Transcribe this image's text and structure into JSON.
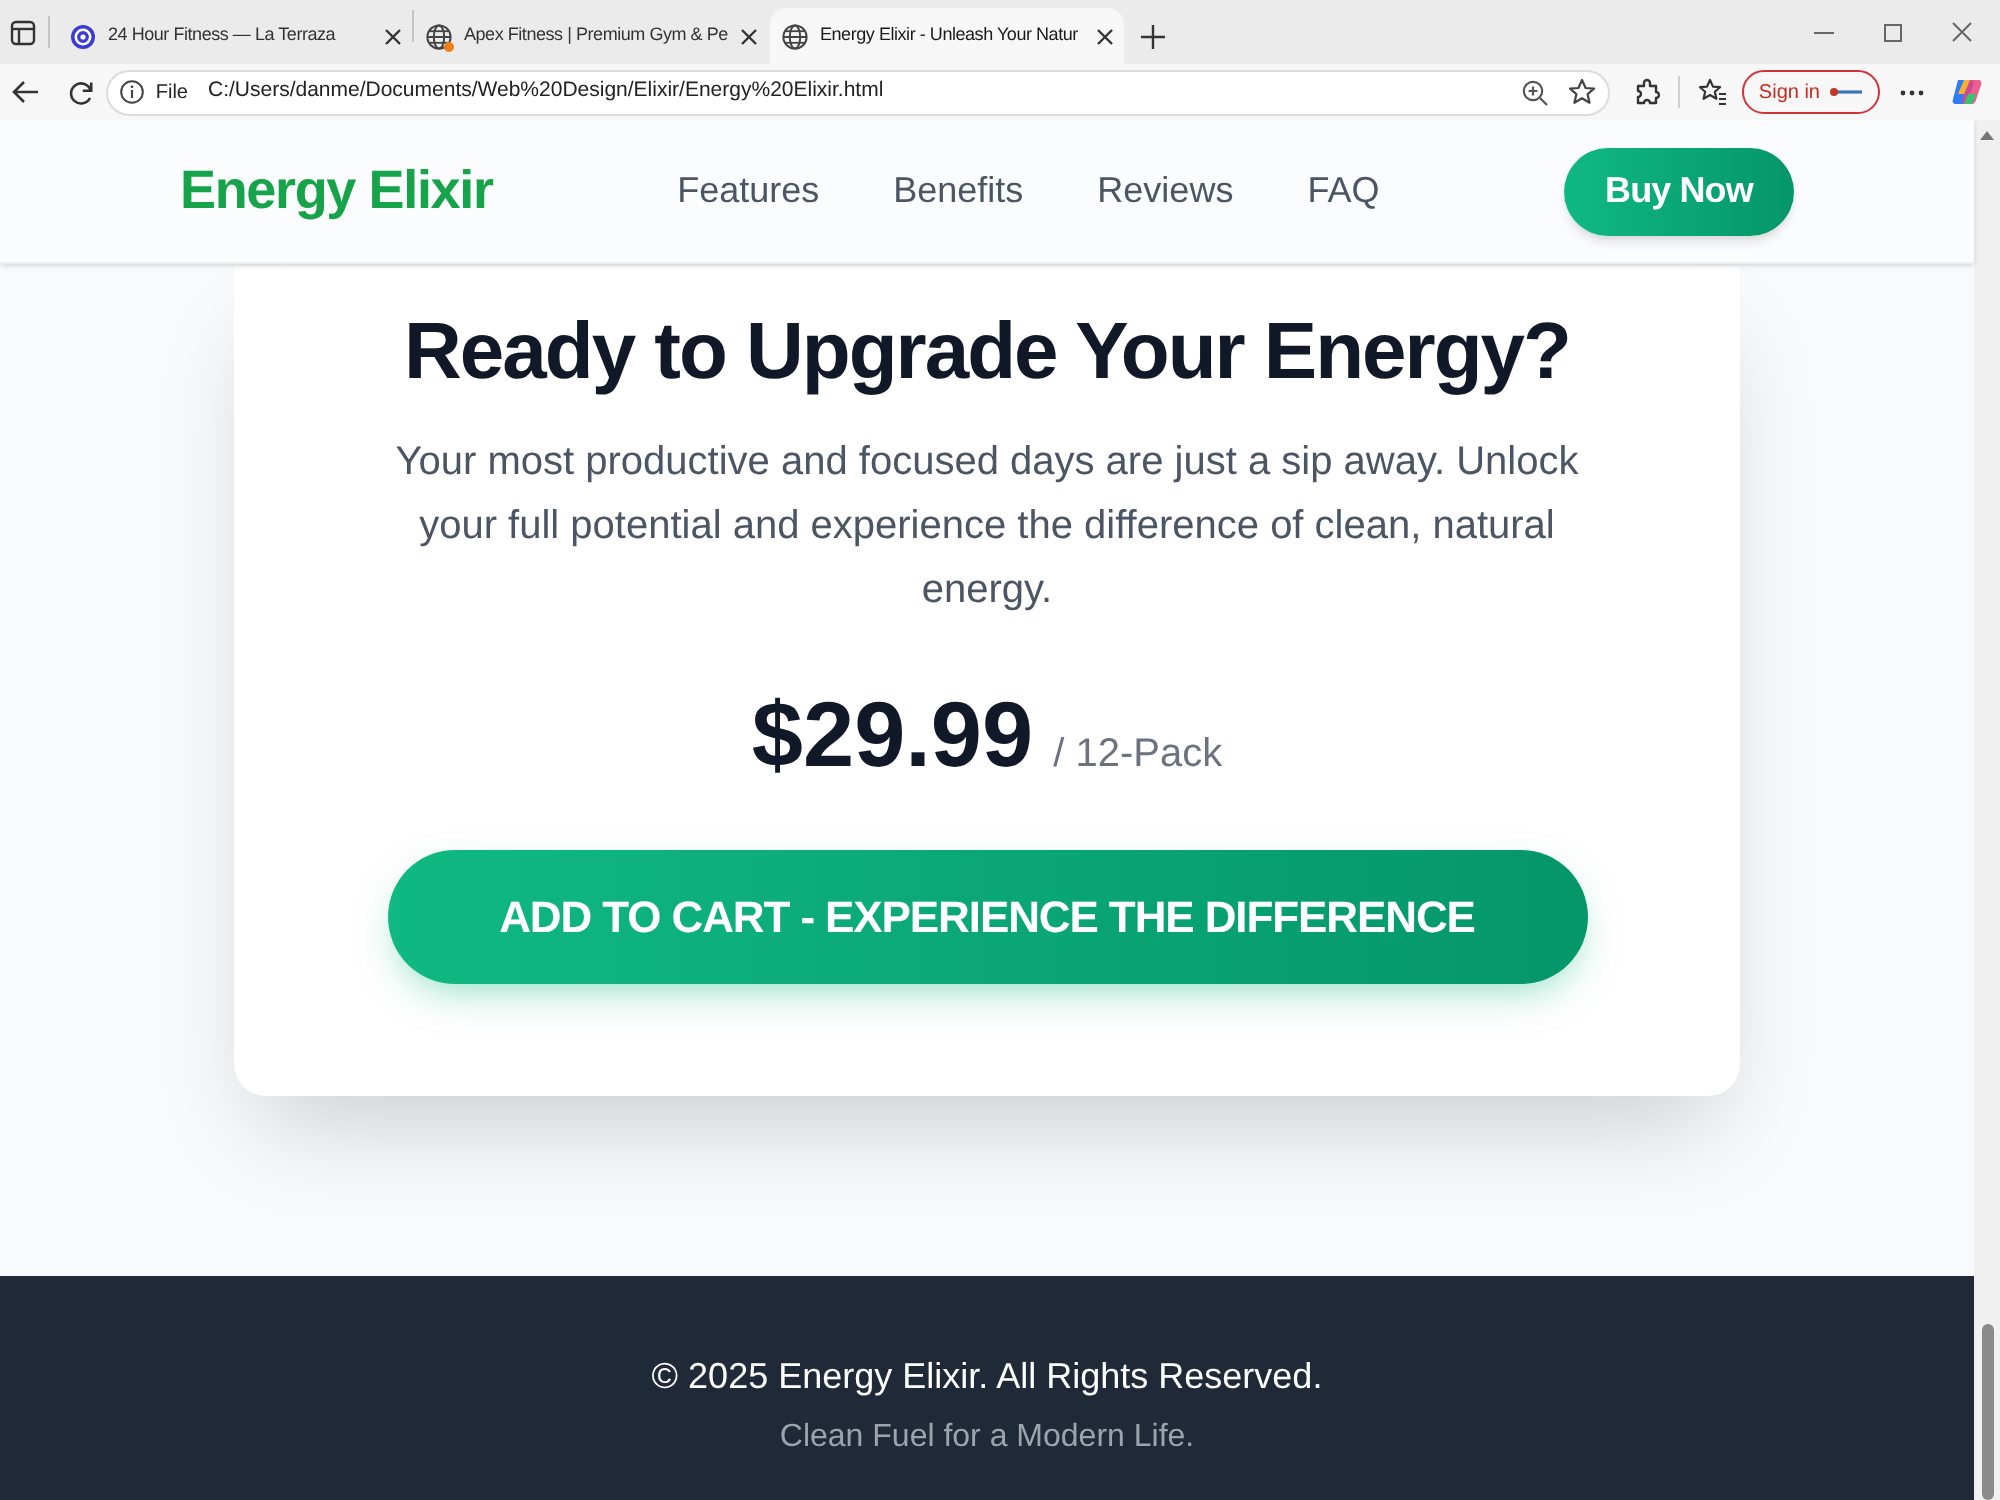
{
  "browser": {
    "tabs": [
      {
        "title": "24 Hour Fitness — La Terraza",
        "kind": "logo",
        "notification": false,
        "selected": false
      },
      {
        "title": "Apex Fitness | Premium Gym & Pe",
        "kind": "globe",
        "notification": true,
        "selected": false
      },
      {
        "title": "Energy Elixir - Unleash Your Natur",
        "kind": "globe",
        "notification": false,
        "selected": true
      }
    ],
    "address": {
      "scheme": "File",
      "url": "C:/Users/danme/Documents/Web%20Design/Elixir/Energy%20Elixir.html"
    },
    "sign_in": "Sign in"
  },
  "header": {
    "logo": "Energy Elixir",
    "nav": [
      "Features",
      "Benefits",
      "Reviews",
      "FAQ"
    ],
    "cta": "Buy Now"
  },
  "cta_section": {
    "heading": "Ready to Upgrade Your Energy?",
    "text": "Your most productive and focused days are just a sip away. Unlock your full potential and experience the difference of clean, natural energy.",
    "price": "$29.99",
    "unit": "/ 12-Pack",
    "button": "ADD TO CART - EXPERIENCE THE DIFFERENCE"
  },
  "footer": {
    "copyright": "© 2025 Energy Elixir. All Rights Reserved.",
    "tagline": "Clean Fuel for a Modern Life."
  }
}
